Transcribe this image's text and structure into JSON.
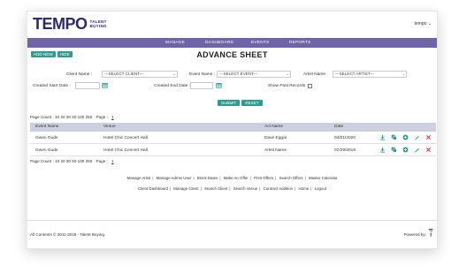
{
  "header": {
    "logo_main": "TEMPO",
    "logo_sub_1": "TALENT",
    "logo_sub_2": "BUYING",
    "user_menu": "tempo ⌄"
  },
  "nav": {
    "items": [
      "MANAGE",
      "DASHBOARD",
      "EVENTS",
      "REPORTS"
    ]
  },
  "toolbar": {
    "add_new": "ADD NEW",
    "hide": "HIDE"
  },
  "page_title": "ADVANCE SHEET",
  "filters": {
    "client_label": "Client Name :",
    "client_value": "---SELECT CLIENT---",
    "event_label": "Event Name :",
    "event_value": "---SELECT EVENT---",
    "artist_label": "Artist Name :",
    "artist_value": "---SELECT ARTIST---",
    "start_label": "Created Start Date :",
    "end_label": "Created End Date :",
    "past_label": "Show Past Records :",
    "submit": "SUBMIT",
    "reset": "RESET"
  },
  "pager": {
    "label": "Page Count :",
    "sizes": "10  20  30  50  100  250",
    "page_label": "Page :",
    "current_page": "1"
  },
  "table": {
    "columns": [
      "Event Name",
      "Venue",
      "Act Name",
      "Date"
    ],
    "rows": [
      {
        "event": "Gwen Gude",
        "venue": "Hotel Chic Concert Hall",
        "act": "Dave Eggar",
        "date": "04/01/2020"
      },
      {
        "event": "Gwen Gude",
        "venue": "Hotel Chic Concert Hall",
        "act": "Artist Name",
        "date": "07/29/2019"
      }
    ]
  },
  "links_row1": [
    "Manage Artist",
    "Manage Admin User",
    "Block Dates",
    "Make An Offer",
    "Print Offers",
    "Search Offers",
    "Master Calendar"
  ],
  "links_row2": [
    "Client Dashboard",
    "Manage Client",
    "Search Client",
    "Search Venue",
    "Contract Addition",
    "Home",
    "Logout"
  ],
  "footer": {
    "copyright": "All Contents © 2011-2019 - Talent Buying",
    "powered_by": "Powered by:"
  },
  "colors": {
    "nav_bg": "#6f64a6",
    "button_teal": "#2f9c8f",
    "header_row": "#cfcde0",
    "action_green": "#2f9c8f",
    "delete_red": "#d9363e"
  }
}
